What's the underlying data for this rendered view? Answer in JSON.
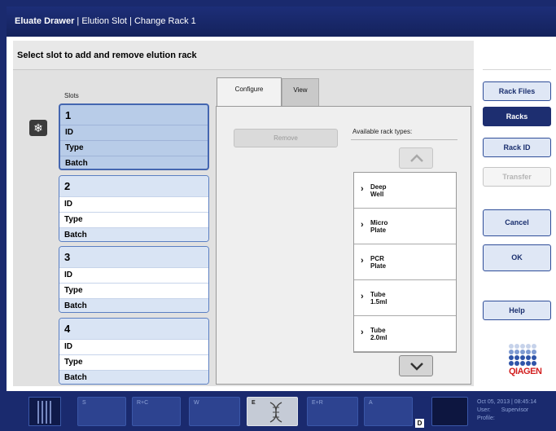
{
  "title": {
    "bold": "Eluate Drawer",
    "rest": " | Elution Slot | Change Rack 1"
  },
  "content": {
    "heading": "Select slot to add and remove elution rack",
    "slots_label": "Slots",
    "slots": [
      {
        "number": "1",
        "id": "ID",
        "type": "Type",
        "batch": "Batch",
        "selected": true
      },
      {
        "number": "2",
        "id": "ID",
        "type": "Type",
        "batch": "Batch",
        "selected": false
      },
      {
        "number": "3",
        "id": "ID",
        "type": "Type",
        "batch": "Batch",
        "selected": false
      },
      {
        "number": "4",
        "id": "ID",
        "type": "Type",
        "batch": "Batch",
        "selected": false
      }
    ],
    "snowflake_icon": "❄"
  },
  "tabs": {
    "configure": "Configure",
    "view": "View"
  },
  "panel": {
    "remove_label": "Remove",
    "available_label": "Available rack types:",
    "racks": [
      {
        "line1": "Deep",
        "line2": "Well"
      },
      {
        "line1": "Micro",
        "line2": "Plate"
      },
      {
        "line1": "PCR",
        "line2": "Plate"
      },
      {
        "line1": "Tube",
        "line2": "1.5ml"
      },
      {
        "line1": "Tube",
        "line2": "2.0ml"
      }
    ]
  },
  "sidebar": {
    "rack_files": "Rack Files",
    "racks": "Racks",
    "rack_id": "Rack ID",
    "transfer": "Transfer",
    "cancel": "Cancel",
    "ok": "OK",
    "help": "Help",
    "logo": "QIAGEN"
  },
  "bottom": {
    "slots": [
      "S",
      "R+C",
      "W",
      "E",
      "E+R",
      "A"
    ],
    "d_badge": "D",
    "datetime": "Oct 05, 2013 | 08:45:14",
    "user_label": "User:",
    "user_value": "Supervisor",
    "profile_label": "Profile:"
  },
  "colors": {
    "brand_navy": "#1a2a6e",
    "selected_slot": "#b8cce8",
    "qiagen_red": "#d21f1f",
    "qiagen_blue": "#2f54a8"
  }
}
